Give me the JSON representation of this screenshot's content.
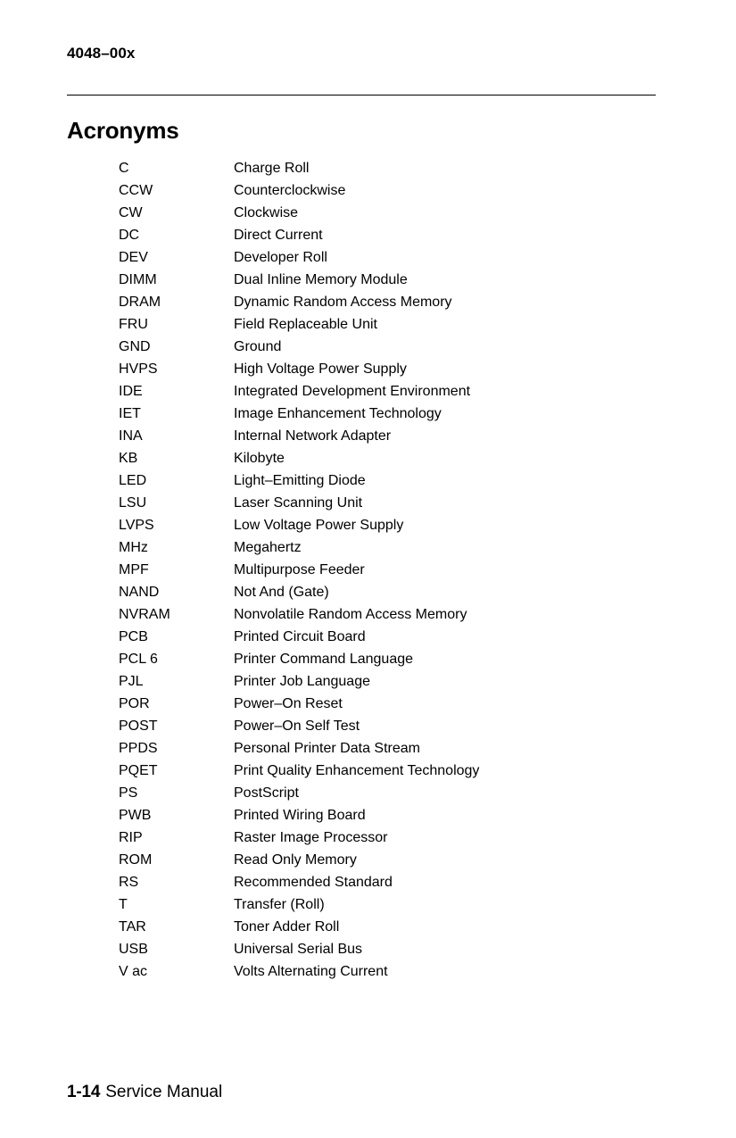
{
  "header": {
    "running_head": "4048–00x"
  },
  "title": "Acronyms",
  "acronyms": [
    {
      "term": "C",
      "definition": "Charge Roll"
    },
    {
      "term": "CCW",
      "definition": "Counterclockwise"
    },
    {
      "term": "CW",
      "definition": "Clockwise"
    },
    {
      "term": "DC",
      "definition": "Direct Current"
    },
    {
      "term": "DEV",
      "definition": "Developer Roll"
    },
    {
      "term": "DIMM",
      "definition": "Dual Inline Memory Module"
    },
    {
      "term": "DRAM",
      "definition": "Dynamic Random Access Memory"
    },
    {
      "term": "FRU",
      "definition": "Field Replaceable Unit"
    },
    {
      "term": "GND",
      "definition": "Ground"
    },
    {
      "term": "HVPS",
      "definition": "High Voltage Power Supply"
    },
    {
      "term": "IDE",
      "definition": "Integrated Development Environment"
    },
    {
      "term": "IET",
      "definition": "Image Enhancement Technology"
    },
    {
      "term": "INA",
      "definition": "Internal Network Adapter"
    },
    {
      "term": "KB",
      "definition": "Kilobyte"
    },
    {
      "term": "LED",
      "definition": "Light–Emitting Diode"
    },
    {
      "term": "LSU",
      "definition": "Laser Scanning Unit"
    },
    {
      "term": "LVPS",
      "definition": "Low Voltage Power Supply"
    },
    {
      "term": "MHz",
      "definition": "Megahertz"
    },
    {
      "term": "MPF",
      "definition": "Multipurpose Feeder"
    },
    {
      "term": "NAND",
      "definition": "Not And (Gate)"
    },
    {
      "term": "NVRAM",
      "definition": "Nonvolatile Random Access Memory"
    },
    {
      "term": "PCB",
      "definition": "Printed Circuit Board"
    },
    {
      "term": "PCL 6",
      "definition": "Printer Command Language"
    },
    {
      "term": "PJL",
      "definition": "Printer Job Language"
    },
    {
      "term": "POR",
      "definition": "Power–On Reset"
    },
    {
      "term": "POST",
      "definition": "Power–On Self Test"
    },
    {
      "term": "PPDS",
      "definition": "Personal Printer Data Stream"
    },
    {
      "term": "PQET",
      "definition": "Print Quality Enhancement Technology"
    },
    {
      "term": "PS",
      "definition": "PostScript"
    },
    {
      "term": "PWB",
      "definition": "Printed Wiring Board"
    },
    {
      "term": "RIP",
      "definition": "Raster Image Processor"
    },
    {
      "term": "ROM",
      "definition": "Read Only Memory"
    },
    {
      "term": "RS",
      "definition": "Recommended Standard"
    },
    {
      "term": "T",
      "definition": "Transfer (Roll)"
    },
    {
      "term": "TAR",
      "definition": "Toner Adder Roll"
    },
    {
      "term": "USB",
      "definition": "Universal Serial Bus"
    },
    {
      "term": "V ac",
      "definition": "Volts Alternating Current"
    }
  ],
  "footer": {
    "page_number": "1-14",
    "label": "Service Manual"
  }
}
